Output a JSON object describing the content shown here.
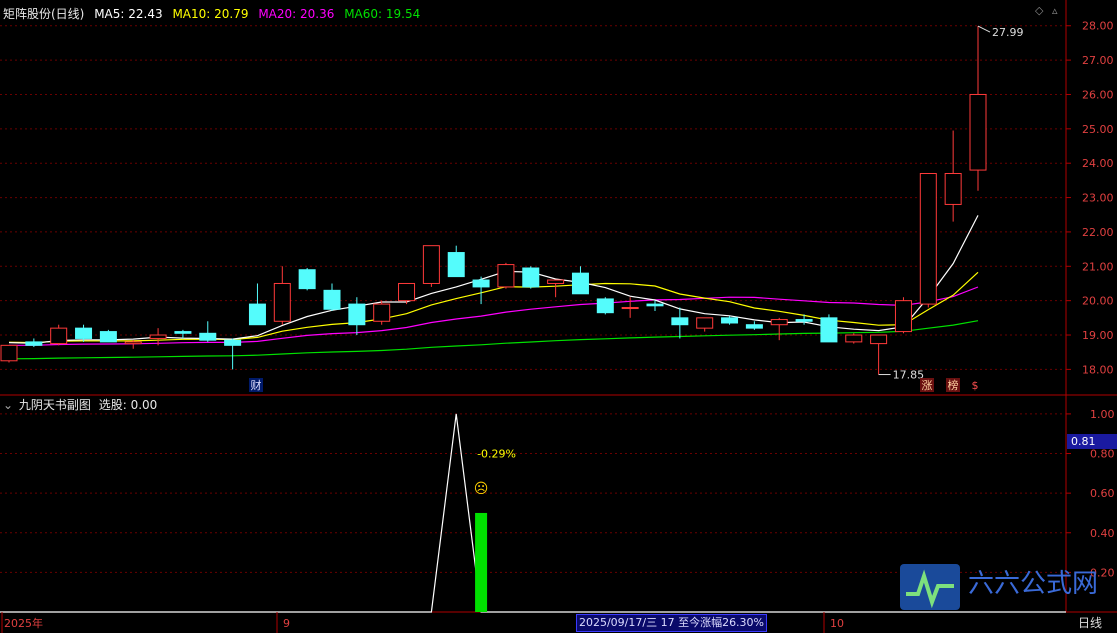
{
  "main_legend": {
    "title": "矩阵股份(日线)",
    "ma5": "MA5: 22.43",
    "ma10": "MA10: 20.79",
    "ma20": "MA20: 20.36",
    "ma60": "MA60: 19.54"
  },
  "sub_legend": {
    "title": "九阴天书副图",
    "value": "选股: 0.00"
  },
  "colors": {
    "up": "#ff3a3a",
    "down": "#54fcfc",
    "ma5": "#ffffff",
    "ma10": "#ffff00",
    "ma20": "#ff00ff",
    "ma60": "#00e000",
    "axis": "#b00000",
    "grid": "#6a0000"
  },
  "status_bar": "2025/09/17/三 17 至今涨幅26.30%",
  "cursor_tag": "0.81",
  "period_label": "日线",
  "markers": {
    "cai": "财",
    "zhang": "涨",
    "bang": "榜",
    "dollar": "$"
  },
  "chart_data": [
    {
      "type": "candlestick",
      "title": "矩阵股份(日线)",
      "ylim": [
        17.4,
        28.4
      ],
      "yticks": [
        "28.00",
        "27.00",
        "26.00",
        "25.00",
        "24.00",
        "23.00",
        "22.00",
        "21.00",
        "20.00",
        "19.00",
        "18.00"
      ],
      "x_labels": [
        "2025年",
        "9",
        "10"
      ],
      "annotations": {
        "high": "27.99",
        "low": "17.85"
      },
      "candles": [
        {
          "o": 18.25,
          "h": 18.65,
          "l": 18.2,
          "c": 18.7
        },
        {
          "o": 18.8,
          "h": 18.9,
          "l": 18.65,
          "c": 18.7
        },
        {
          "o": 18.75,
          "h": 19.3,
          "l": 18.7,
          "c": 19.2
        },
        {
          "o": 19.2,
          "h": 19.3,
          "l": 18.8,
          "c": 18.9
        },
        {
          "o": 19.1,
          "h": 19.15,
          "l": 18.8,
          "c": 18.8
        },
        {
          "o": 18.75,
          "h": 18.85,
          "l": 18.6,
          "c": 18.8
        },
        {
          "o": 18.9,
          "h": 19.2,
          "l": 18.7,
          "c": 19.0
        },
        {
          "o": 19.1,
          "h": 19.15,
          "l": 18.9,
          "c": 19.05
        },
        {
          "o": 19.05,
          "h": 19.4,
          "l": 18.8,
          "c": 18.85
        },
        {
          "o": 18.85,
          "h": 18.9,
          "l": 18.0,
          "c": 18.7
        },
        {
          "o": 19.9,
          "h": 20.5,
          "l": 19.3,
          "c": 19.3
        },
        {
          "o": 19.4,
          "h": 21.0,
          "l": 19.3,
          "c": 20.5
        },
        {
          "o": 20.9,
          "h": 20.95,
          "l": 20.3,
          "c": 20.35
        },
        {
          "o": 20.3,
          "h": 20.5,
          "l": 19.7,
          "c": 19.75
        },
        {
          "o": 19.9,
          "h": 20.1,
          "l": 19.0,
          "c": 19.3
        },
        {
          "o": 19.4,
          "h": 20.0,
          "l": 19.3,
          "c": 19.9
        },
        {
          "o": 20.0,
          "h": 20.5,
          "l": 19.9,
          "c": 20.5
        },
        {
          "o": 20.5,
          "h": 21.6,
          "l": 20.4,
          "c": 21.6
        },
        {
          "o": 21.4,
          "h": 21.6,
          "l": 20.7,
          "c": 20.7
        },
        {
          "o": 20.6,
          "h": 20.7,
          "l": 19.9,
          "c": 20.4
        },
        {
          "o": 20.4,
          "h": 21.1,
          "l": 20.35,
          "c": 21.05
        },
        {
          "o": 20.95,
          "h": 21.0,
          "l": 20.35,
          "c": 20.4
        },
        {
          "o": 20.5,
          "h": 20.6,
          "l": 20.1,
          "c": 20.6
        },
        {
          "o": 20.8,
          "h": 21.0,
          "l": 20.2,
          "c": 20.2
        },
        {
          "o": 20.05,
          "h": 20.1,
          "l": 19.6,
          "c": 19.65
        },
        {
          "o": 19.8,
          "h": 20.1,
          "l": 19.5,
          "c": 19.8
        },
        {
          "o": 19.9,
          "h": 20.0,
          "l": 19.7,
          "c": 19.85
        },
        {
          "o": 19.5,
          "h": 19.8,
          "l": 18.9,
          "c": 19.3
        },
        {
          "o": 19.2,
          "h": 19.5,
          "l": 19.1,
          "c": 19.5
        },
        {
          "o": 19.5,
          "h": 19.55,
          "l": 19.3,
          "c": 19.35
        },
        {
          "o": 19.3,
          "h": 19.4,
          "l": 19.15,
          "c": 19.2
        },
        {
          "o": 19.3,
          "h": 19.5,
          "l": 18.85,
          "c": 19.45
        },
        {
          "o": 19.45,
          "h": 19.6,
          "l": 19.3,
          "c": 19.4
        },
        {
          "o": 19.5,
          "h": 19.6,
          "l": 18.8,
          "c": 18.8
        },
        {
          "o": 18.8,
          "h": 19.05,
          "l": 18.75,
          "c": 19.0
        },
        {
          "o": 18.75,
          "h": 19.0,
          "l": 17.85,
          "c": 19.0
        },
        {
          "o": 19.1,
          "h": 20.1,
          "l": 19.05,
          "c": 20.0
        },
        {
          "o": 19.9,
          "h": 23.7,
          "l": 19.8,
          "c": 23.7
        },
        {
          "o": 22.8,
          "h": 24.95,
          "l": 22.3,
          "c": 23.7
        },
        {
          "o": 23.8,
          "h": 27.99,
          "l": 23.2,
          "c": 26.0
        }
      ]
    },
    {
      "type": "line",
      "title": "九阴天书副图",
      "ylim": [
        0,
        1.05
      ],
      "yticks": [
        "1.00",
        "0.80",
        "0.60",
        "0.40",
        "0.20"
      ],
      "series": [
        {
          "values": [
            0,
            0,
            0,
            0,
            0,
            0,
            0,
            0,
            0,
            0,
            0,
            0,
            0,
            0,
            0,
            0,
            0,
            0,
            1,
            0,
            0,
            0,
            0,
            0,
            0,
            0,
            0,
            0,
            0,
            0,
            0,
            0,
            0,
            0,
            0,
            0,
            0,
            0,
            0,
            0
          ]
        }
      ],
      "bars": [
        {
          "index": 19,
          "value": 0.5
        }
      ],
      "annotations": {
        "pct": "-0.29%",
        "face": "☹"
      }
    }
  ]
}
